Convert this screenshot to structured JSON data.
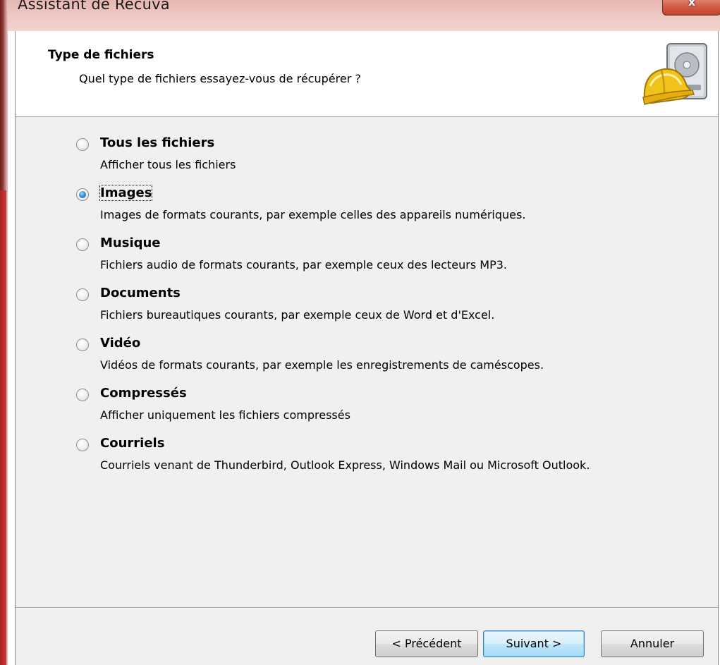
{
  "window": {
    "title": "Assistant de Recuva",
    "close_glyph": "x"
  },
  "header": {
    "title": "Type de fichiers",
    "subtitle": "Quel type de fichiers essayez-vous de récupérer ?",
    "logo_icon": "recuva-hardhat-disk-icon"
  },
  "options": [
    {
      "label": "Tous les fichiers",
      "description": "Afficher tous les fichiers",
      "checked": false
    },
    {
      "label": "Images",
      "description": "Images de formats courants, par exemple celles des appareils numériques.",
      "checked": true
    },
    {
      "label": "Musique",
      "description": "Fichiers audio de formats courants, par exemple ceux des lecteurs MP3.",
      "checked": false
    },
    {
      "label": "Documents",
      "description": "Fichiers bureautiques courants, par exemple ceux de Word et d'Excel.",
      "checked": false
    },
    {
      "label": "Vidéo",
      "description": "Vidéos de formats courants, par exemple les enregistrements de caméscopes.",
      "checked": false
    },
    {
      "label": "Compressés",
      "description": "Afficher uniquement les fichiers compressés",
      "checked": false
    },
    {
      "label": "Courriels",
      "description": "Courriels venant de Thunderbird, Outlook Express, Windows Mail ou Microsoft Outlook.",
      "checked": false
    }
  ],
  "buttons": {
    "previous": "< Précédent",
    "next": "Suivant >",
    "cancel": "Annuler"
  },
  "colors": {
    "title_bar": "#efc9c4",
    "frame_accent": "#c83a3a",
    "default_button": "#bee6fd",
    "dialog_bg": "#f0f0f0"
  }
}
